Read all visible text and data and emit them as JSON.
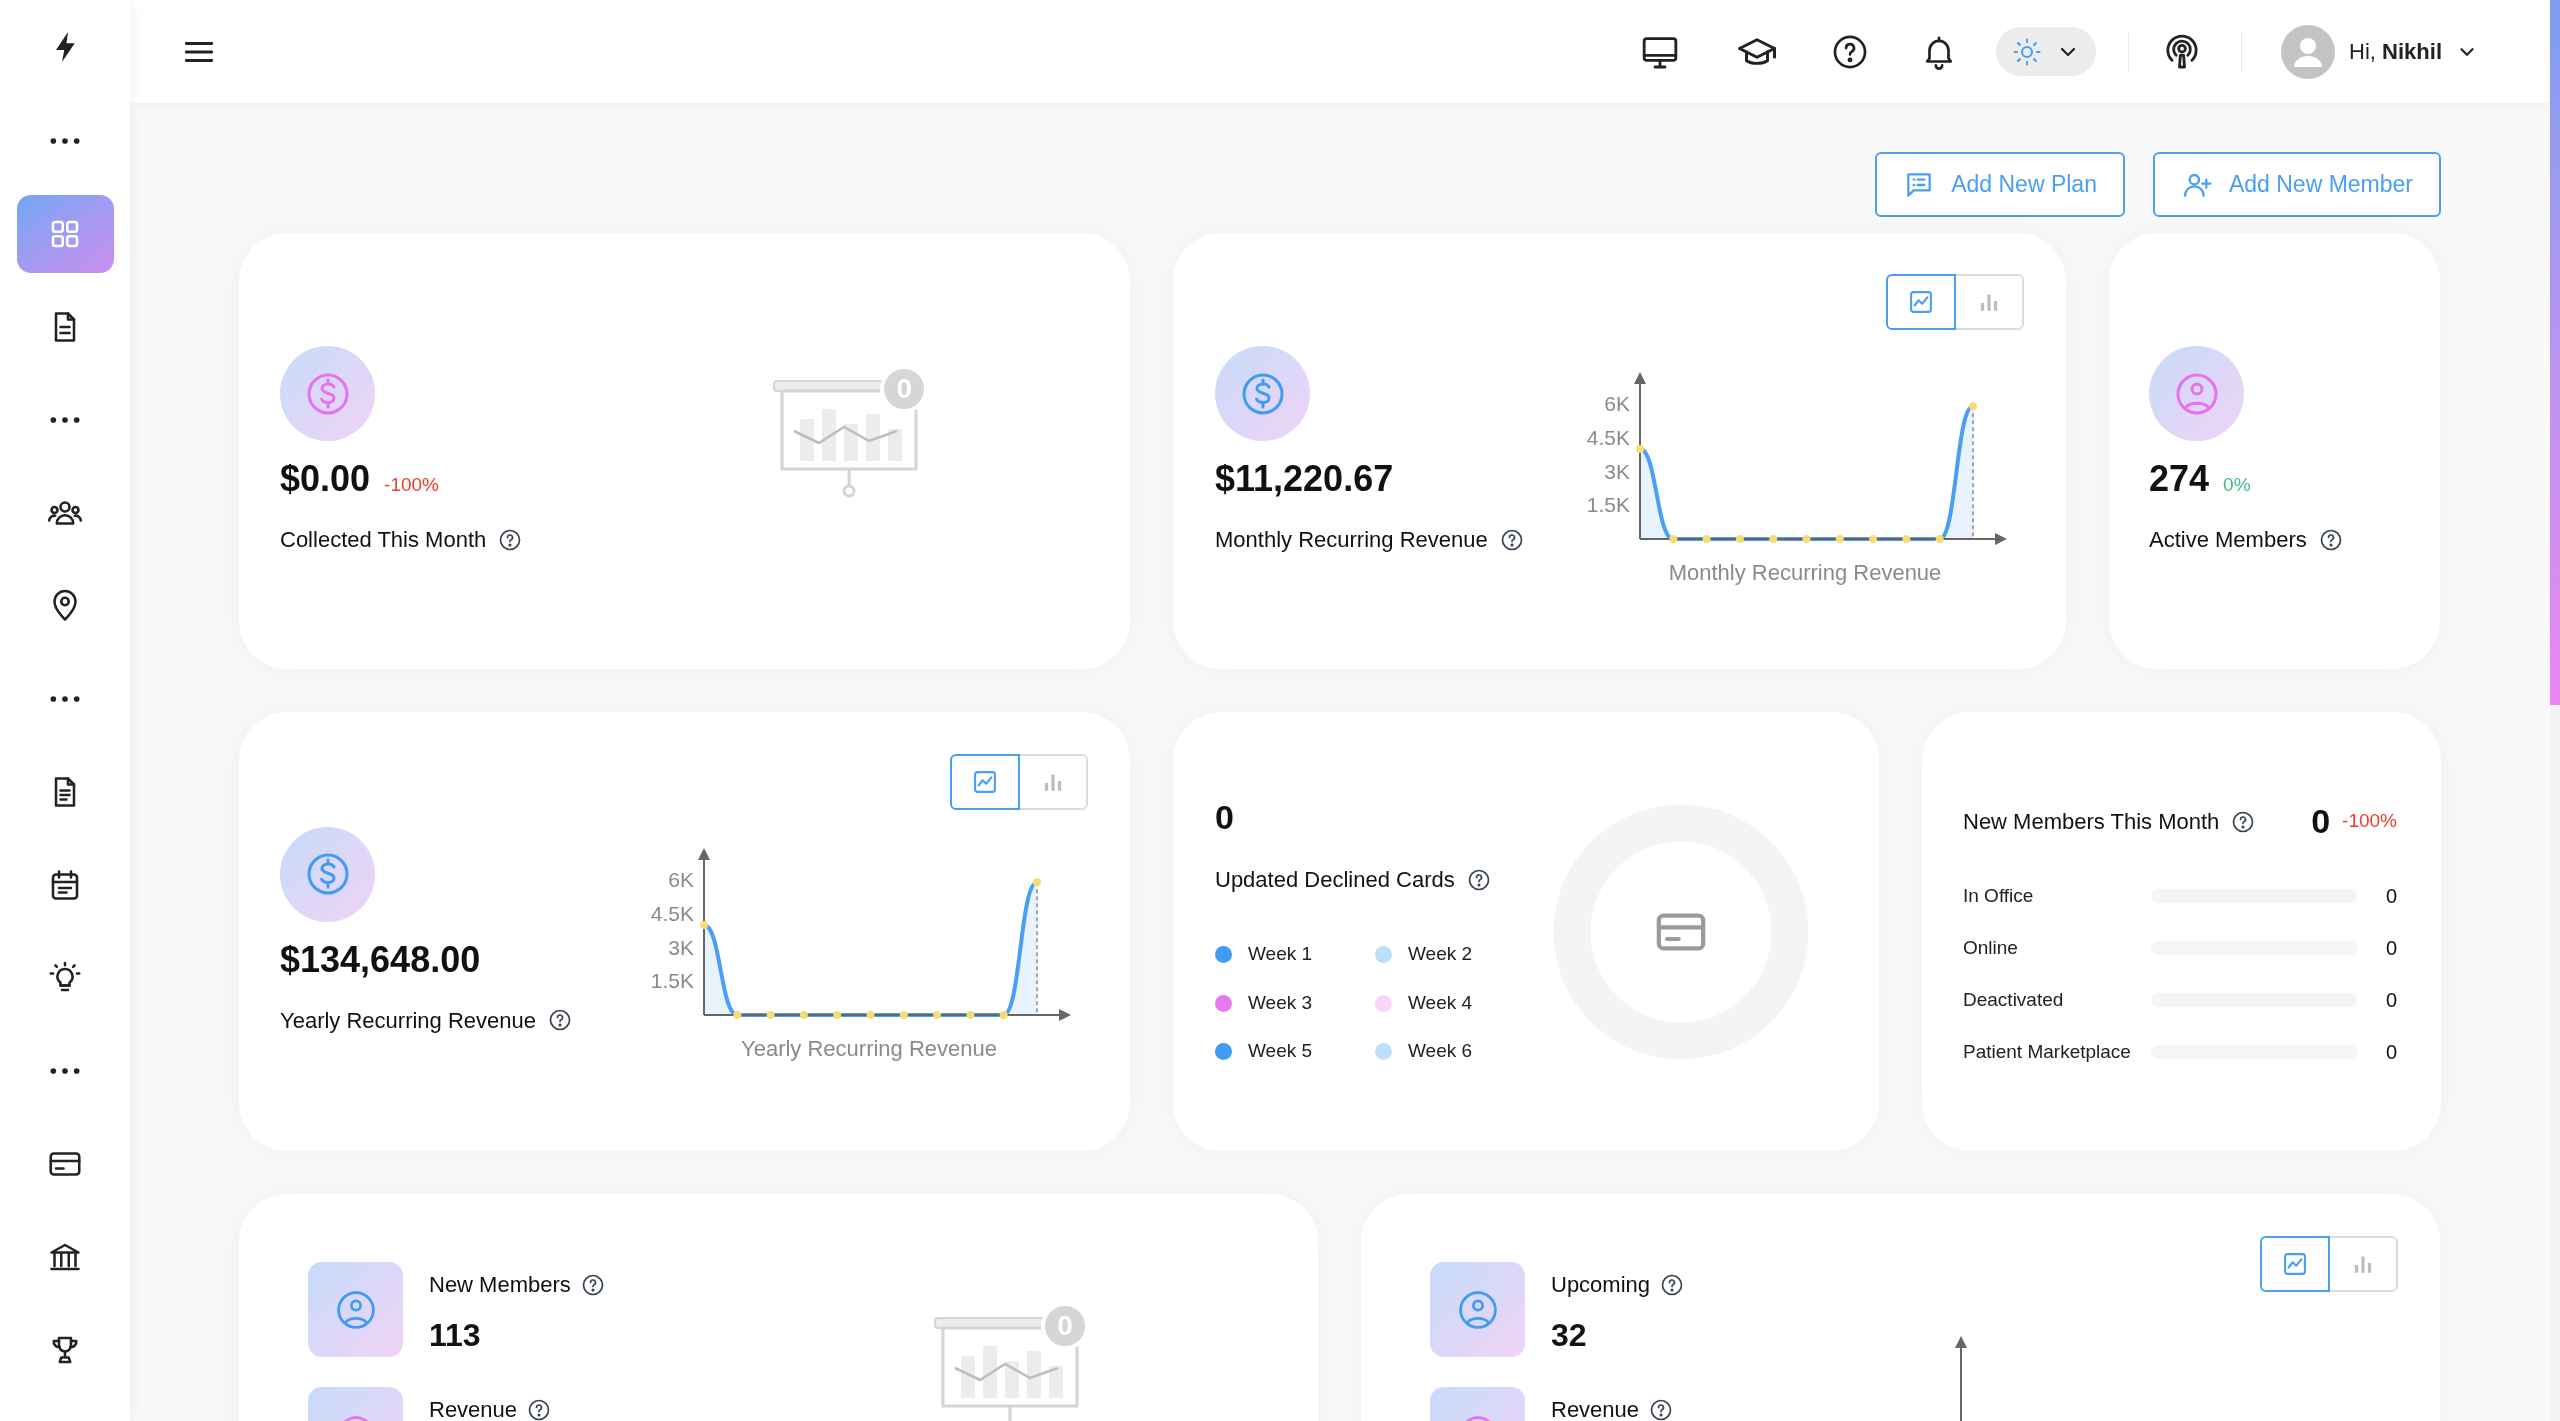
{
  "sidebar": {
    "items": [
      {
        "kind": "dots",
        "selected": false
      },
      {
        "kind": "grid",
        "selected": true
      },
      {
        "kind": "document",
        "selected": false
      },
      {
        "kind": "dots",
        "selected": false
      },
      {
        "kind": "people",
        "selected": false
      },
      {
        "kind": "pin",
        "selected": false
      },
      {
        "kind": "dots",
        "selected": false
      },
      {
        "kind": "file",
        "selected": false
      },
      {
        "kind": "calendar",
        "selected": false
      },
      {
        "kind": "bulb",
        "selected": false
      },
      {
        "kind": "dots",
        "selected": false
      },
      {
        "kind": "card",
        "selected": false
      },
      {
        "kind": "bank",
        "selected": false
      },
      {
        "kind": "trophy",
        "selected": false
      }
    ]
  },
  "header": {
    "light_theme": true,
    "greeting": "Hi, **Nikhil**"
  },
  "actions": [
    {
      "kind": "plan",
      "label": "Add New Plan"
    },
    {
      "kind": "member",
      "label": "Add New Member"
    }
  ],
  "collected_this_month": {
    "value": "$0.00",
    "change": "-100%",
    "negative": true,
    "label": "Collected This Month",
    "empty_badge": "0"
  },
  "monthly_recurring_revenue": {
    "value": "$11,220.67",
    "label": "Monthly Recurring Revenue",
    "view_toggle": [
      {
        "kind": "line",
        "selected": true
      },
      {
        "kind": "bar",
        "selected": false
      }
    ],
    "chart_data": {
      "type": "area",
      "xlabel": "Monthly Recurring Revenue",
      "values": [
        4000,
        0,
        0,
        0,
        0,
        0,
        0,
        0,
        0,
        0,
        5900
      ],
      "ylim": [
        0,
        6000
      ],
      "yticks": [
        {
          "value": 1500,
          "label": "1.5K"
        },
        {
          "value": 3000,
          "label": "3K"
        },
        {
          "value": 4500,
          "label": "4.5K"
        },
        {
          "value": 6000,
          "label": "6K"
        }
      ]
    }
  },
  "active_members": {
    "value": "274",
    "change": "0%",
    "negative": false,
    "label": "Active Members"
  },
  "yearly_recurring_revenue": {
    "value": "$134,648.00",
    "label": "Yearly Recurring Revenue",
    "view_toggle": [
      {
        "kind": "line",
        "selected": true
      },
      {
        "kind": "bar",
        "selected": false
      }
    ],
    "chart_data": {
      "type": "area",
      "xlabel": "Yearly Recurring Revenue",
      "values": [
        4000,
        0,
        0,
        0,
        0,
        0,
        0,
        0,
        0,
        0,
        5900
      ],
      "ylim": [
        0,
        6000
      ],
      "yticks": [
        {
          "value": 1500,
          "label": "1.5K"
        },
        {
          "value": 3000,
          "label": "3K"
        },
        {
          "value": 4500,
          "label": "4.5K"
        },
        {
          "value": 6000,
          "label": "6K"
        }
      ]
    }
  },
  "updated_declined_cards": {
    "value": "0",
    "label": "Updated Declined Cards",
    "legend": [
      {
        "label": "Week 1",
        "color": "#3f9cf2"
      },
      {
        "label": "Week 2",
        "color": "#bde0fa"
      },
      {
        "label": "Week 3",
        "color": "#e779ee"
      },
      {
        "label": "Week 4",
        "color": "#f7d6f9"
      },
      {
        "label": "Week 5",
        "color": "#3f9cf2"
      },
      {
        "label": "Week 6",
        "color": "#bde0fa"
      }
    ]
  },
  "new_members_this_month": {
    "label": "New Members This Month",
    "value": "0",
    "change": "-100%",
    "negative": true,
    "rows": [
      {
        "label": "In Office",
        "level": 0,
        "value": "0"
      },
      {
        "label": "Online",
        "level": 0,
        "value": "0"
      },
      {
        "label": "Deactivated",
        "level": 0,
        "value": "0"
      },
      {
        "label": "Patient Marketplace",
        "level": 0,
        "value": "0"
      }
    ]
  },
  "new_members": {
    "stats": [
      {
        "label": "New Members",
        "value": "113"
      },
      {
        "label": "Revenue"
      }
    ],
    "empty_badge": "0"
  },
  "upcoming": {
    "stats": [
      {
        "label": "Upcoming",
        "value": "32"
      },
      {
        "label": "Revenue"
      }
    ],
    "view_toggle": [
      {
        "kind": "line",
        "selected": true
      },
      {
        "kind": "bar",
        "selected": false
      }
    ]
  }
}
